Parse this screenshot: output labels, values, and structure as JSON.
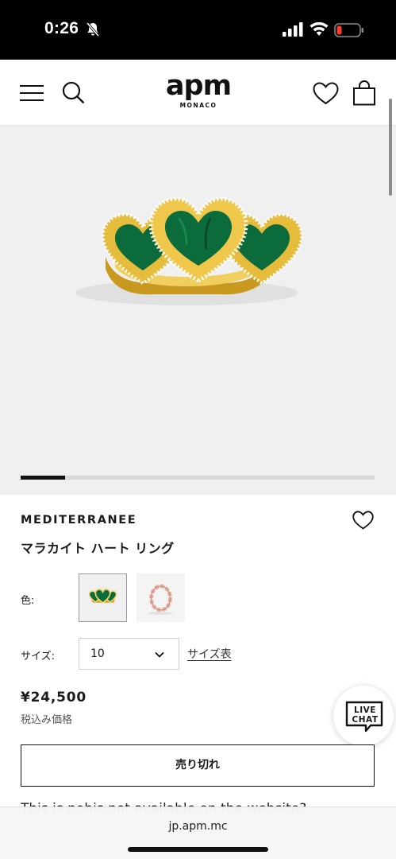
{
  "status_bar": {
    "time": "0:26",
    "icons": [
      "bell-slash-icon",
      "cellular-signal-icon",
      "wifi-icon",
      "battery-low-icon"
    ],
    "battery_color": "#ff3b30"
  },
  "header": {
    "logo_text": "apm",
    "logo_subtitle": "MONACO",
    "icons": [
      "menu-icon",
      "search-icon",
      "heart-icon",
      "shopping-bag-icon"
    ]
  },
  "gallery": {
    "image": "malachite-heart-ring",
    "progress": 0.125
  },
  "product": {
    "collection": "MEDITERRANEE",
    "name": "マラカイト ハート リング",
    "color_label": "色:",
    "swatches": [
      {
        "name": "gold-malachite",
        "selected": true
      },
      {
        "name": "rose-gold",
        "selected": false
      }
    ],
    "size_label": "サイズ:",
    "size_value": "10",
    "size_guide": "サイズ表",
    "price": "¥24,500",
    "tax_note": "税込み価格",
    "button_label": "売り切れ",
    "description": "This is nobis not available on the website?"
  },
  "live_chat": {
    "line1": "LIVE",
    "line2": "CHAT"
  },
  "browser": {
    "url": "jp.apm.mc"
  },
  "colors": {
    "accent": "#111111",
    "gallery_bg": "#f0f0f0",
    "malachite": "#0b6b3a",
    "gold": "#e2b93b"
  }
}
